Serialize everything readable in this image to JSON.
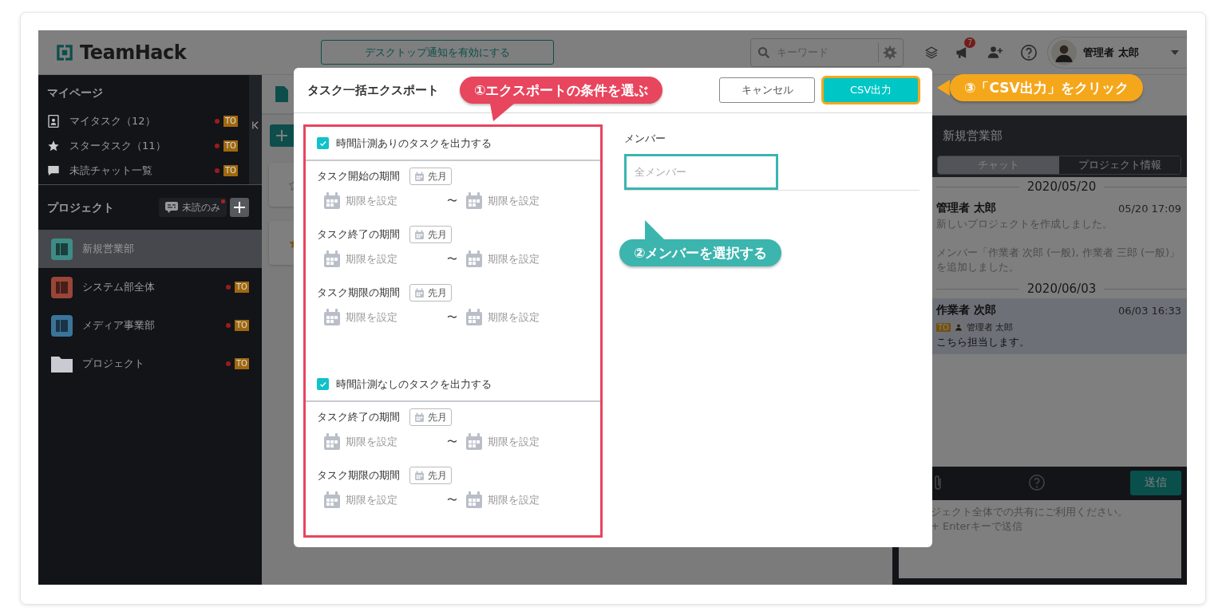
{
  "header": {
    "logo": "TeamHack",
    "notify_button": "デスクトップ通知を有効にする",
    "search": {
      "placeholder": "キーワード"
    },
    "notification_count": "7",
    "user_name": "管理者 太郎"
  },
  "sidebar": {
    "mypage": {
      "title": "マイページ",
      "items": [
        {
          "kind": "person",
          "label": "マイタスク（12）",
          "unread": true,
          "badge": "TO"
        },
        {
          "kind": "star",
          "label": "スタータスク（11）",
          "unread": true,
          "badge": "TO"
        },
        {
          "kind": "chat",
          "label": "未読チャット一覧",
          "unread": true,
          "badge": "TO"
        }
      ]
    },
    "projects": {
      "title": "プロジェクト",
      "filter": "未読のみ",
      "items": [
        {
          "kind": "board",
          "label": "新規営業部",
          "color": "#3d8c85",
          "selected": true,
          "unread": false
        },
        {
          "kind": "board",
          "label": "システム部全体",
          "color": "#9a4538",
          "selected": false,
          "unread": true,
          "badge": "TO"
        },
        {
          "kind": "board",
          "label": "メディア事業部",
          "color": "#3b7499",
          "selected": false,
          "unread": true,
          "badge": "TO"
        },
        {
          "kind": "folder",
          "label": "プロジェクト",
          "selected": false,
          "unread": true,
          "badge": "TO"
        }
      ]
    }
  },
  "main": {
    "cards": [
      {
        "starred": false
      },
      {
        "starred": true
      }
    ]
  },
  "chat": {
    "project_name": "新規営業部",
    "tabs": [
      {
        "label": "チャット",
        "selected": true
      },
      {
        "label": "プロジェクト情報",
        "selected": false
      }
    ],
    "timeline": [
      {
        "kind": "date",
        "text": "2020/05/20"
      },
      {
        "kind": "message",
        "author": "管理者 太郎",
        "time": "05/20 17:09",
        "system": true,
        "highlighted": false,
        "paragraphs": [
          "新しいプロジェクトを作成しました。",
          "メンバー「作業者 次郎 (一般), 作業者 三郎 (一般)」を追加しました。"
        ]
      },
      {
        "kind": "date",
        "text": "2020/06/03"
      },
      {
        "kind": "message",
        "author": "作業者 次郎",
        "time": "06/03 16:33",
        "system": false,
        "highlighted": true,
        "to": {
          "badge": "TO",
          "name": "管理者 太郎"
        },
        "paragraphs": [
          "こちら担当します。"
        ]
      }
    ],
    "composer": {
      "send_button": "送信",
      "placeholder": "ジェクト全体での共有にご利用ください。\n+ Enterキーで送信"
    }
  },
  "modal": {
    "title": "タスク一括エクスポート",
    "cancel_button": "キャンセル",
    "export_button": "CSV出力",
    "sections": [
      {
        "label": "時間計測ありのタスクを出力する",
        "checked": true,
        "periods": [
          {
            "label": "タスク開始の期間",
            "preset": "先月",
            "from": "期限を設定",
            "separator": "〜",
            "to": "期限を設定"
          },
          {
            "label": "タスク終了の期間",
            "preset": "先月",
            "from": "期限を設定",
            "separator": "〜",
            "to": "期限を設定"
          },
          {
            "label": "タスク期限の期間",
            "preset": "先月",
            "from": "期限を設定",
            "separator": "〜",
            "to": "期限を設定"
          }
        ]
      },
      {
        "label": "時間計測なしのタスクを出力する",
        "checked": true,
        "periods": [
          {
            "label": "タスク終了の期間",
            "preset": "先月",
            "from": "期限を設定",
            "separator": "〜",
            "to": "期限を設定"
          },
          {
            "label": "タスク期限の期間",
            "preset": "先月",
            "from": "期限を設定",
            "separator": "〜",
            "to": "期限を設定"
          }
        ]
      }
    ],
    "member": {
      "label": "メンバー",
      "placeholder": "全メンバー"
    }
  },
  "annotations": [
    {
      "kind": "down",
      "text": "①エクスポートの条件を選ぶ",
      "color": "#e8455e"
    },
    {
      "kind": "up",
      "text": "②メンバーを選択する",
      "color": "#3bb5ae"
    },
    {
      "kind": "left",
      "text": "③「CSV出力」をクリック",
      "color": "#f5a71c"
    }
  ]
}
